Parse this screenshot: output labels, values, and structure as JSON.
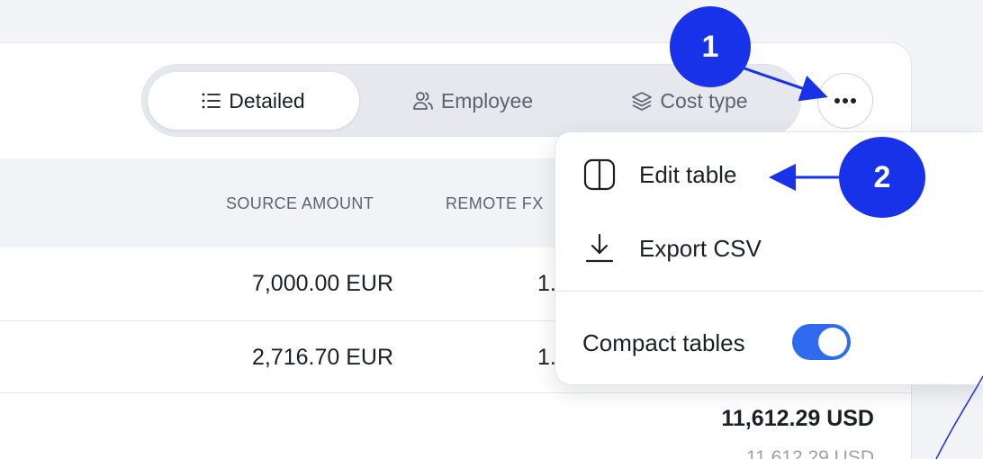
{
  "tabs": [
    {
      "label": "Detailed",
      "icon": "list-icon",
      "active": true
    },
    {
      "label": "Employee",
      "icon": "users-icon",
      "active": false
    },
    {
      "label": "Cost type",
      "icon": "layers-icon",
      "active": false
    }
  ],
  "more_button": {
    "icon": "more-horizontal-icon"
  },
  "table": {
    "columns": {
      "source_amount": "SOURCE AMOUNT",
      "remote_fx": "REMOTE FX"
    },
    "rows": [
      {
        "source_amount": "7,000.00 EUR",
        "remote_fx": "1."
      },
      {
        "source_amount": "2,716.70 EUR",
        "remote_fx": "1."
      }
    ],
    "total": "11,612.29 USD",
    "subtotal": "11,612.29 USD"
  },
  "menu": {
    "edit_table": "Edit table",
    "export_csv": "Export CSV",
    "compact_tables": "Compact tables",
    "compact_tables_on": true
  },
  "annotations": {
    "step1": "1",
    "step2": "2"
  },
  "colors": {
    "accent": "#2f6bf0",
    "annotation": "#1732e8"
  }
}
